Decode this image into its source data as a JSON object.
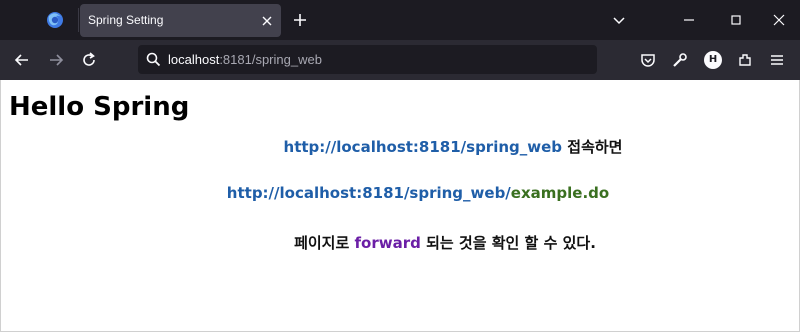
{
  "browser": {
    "tab_title": "Spring Setting",
    "url_host": "localhost",
    "url_rest": ":8181/spring_web",
    "profile_initial": "H"
  },
  "page": {
    "heading": "Hello Spring",
    "line1": {
      "link": "http://localhost:8181/spring_web",
      "suffix": "접속하면"
    },
    "line2": {
      "base": "http://localhost:8181/spring_web/",
      "path": "example.do"
    },
    "line3": {
      "prefix": "페이지로",
      "keyword": "forward",
      "suffix": "되는 것을 확인 할 수 있다."
    }
  },
  "colors": {
    "link_blue": "#1f5ea8",
    "path_green": "#3a7020",
    "keyword_purple": "#6b1fa6",
    "tab_strip_bg": "#1c1b22",
    "toolbar_bg": "#2b2a33"
  },
  "icons": [
    "firefox-icon",
    "close-icon",
    "plus-icon",
    "chevron-down-icon",
    "minimize-icon",
    "maximize-icon",
    "window-close-icon",
    "back-arrow-icon",
    "forward-arrow-icon",
    "reload-icon",
    "search-icon",
    "pocket-icon",
    "wrench-icon",
    "extensions-icon",
    "menu-icon"
  ]
}
